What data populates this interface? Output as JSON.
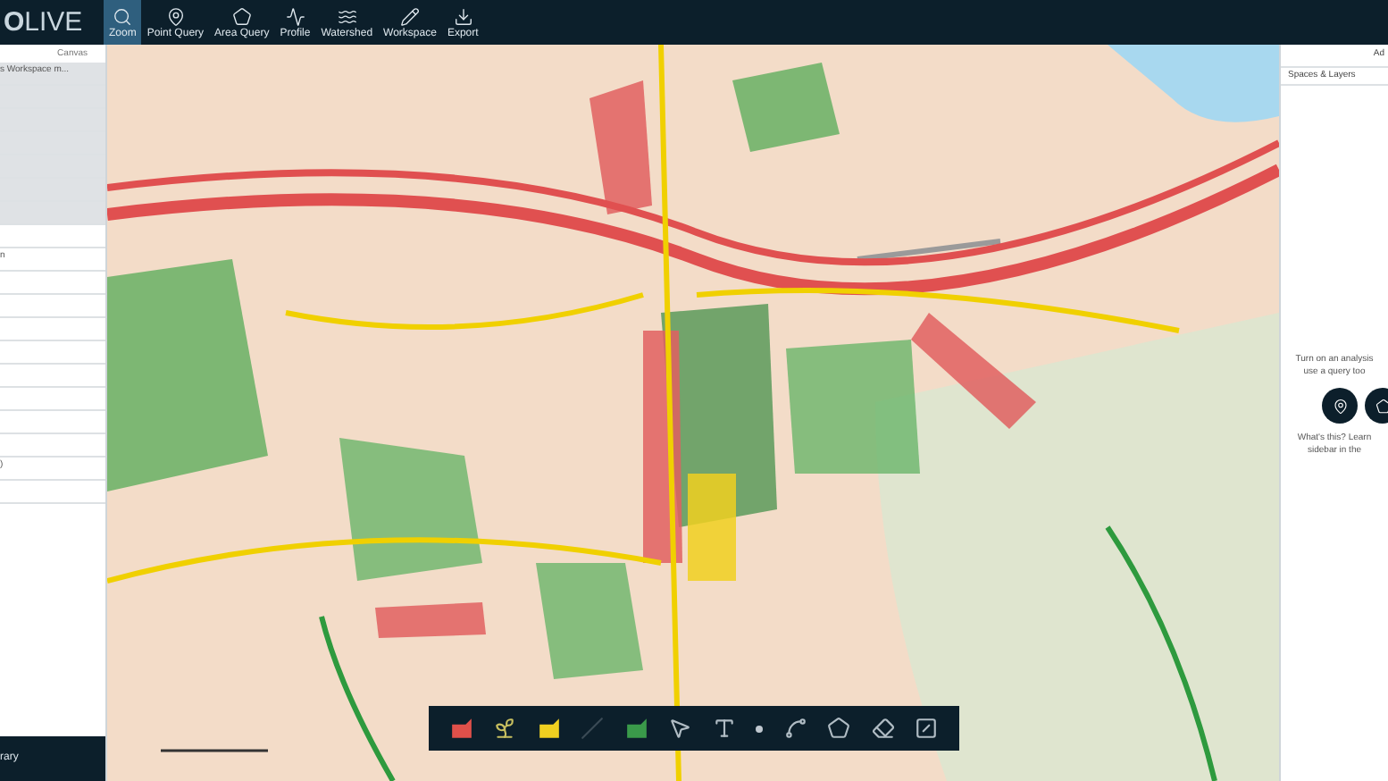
{
  "app_bar": {
    "logo": [
      "O",
      "LIVE"
    ],
    "tools": [
      {
        "label": "Zoom",
        "selected": true
      },
      {
        "label": "Point Query",
        "selected": false
      },
      {
        "label": "Area Query",
        "selected": false
      },
      {
        "label": "Profile",
        "selected": false
      },
      {
        "label": "Watershed",
        "selected": false
      },
      {
        "label": "Workspace",
        "selected": false
      },
      {
        "label": "Export",
        "selected": false
      }
    ]
  },
  "left_panel": {
    "tab": "Canvas",
    "rows": [
      {
        "shaded": true,
        "text": "s Workspace m..."
      },
      {
        "shaded": true
      },
      {
        "shaded": true
      },
      {
        "shaded": true
      },
      {
        "shaded": true
      },
      {
        "shaded": true
      },
      {
        "shaded": true
      },
      {
        "shaded": false
      },
      {
        "shaded": false,
        "text": "n"
      },
      {
        "shaded": false
      },
      {
        "shaded": false
      },
      {
        "shaded": false
      },
      {
        "shaded": false
      },
      {
        "shaded": false
      },
      {
        "shaded": false
      },
      {
        "shaded": false
      },
      {
        "shaded": false
      },
      {
        "shaded": false,
        "text": ")"
      },
      {
        "shaded": false
      }
    ],
    "footer": "rary"
  },
  "right_panel": {
    "header": "Ad",
    "tab": "Spaces & Layers",
    "hint_lines": [
      "Turn on an analysis",
      "use a query too"
    ],
    "help_lines": [
      "What's this? Learn",
      "sidebar in the"
    ]
  }
}
